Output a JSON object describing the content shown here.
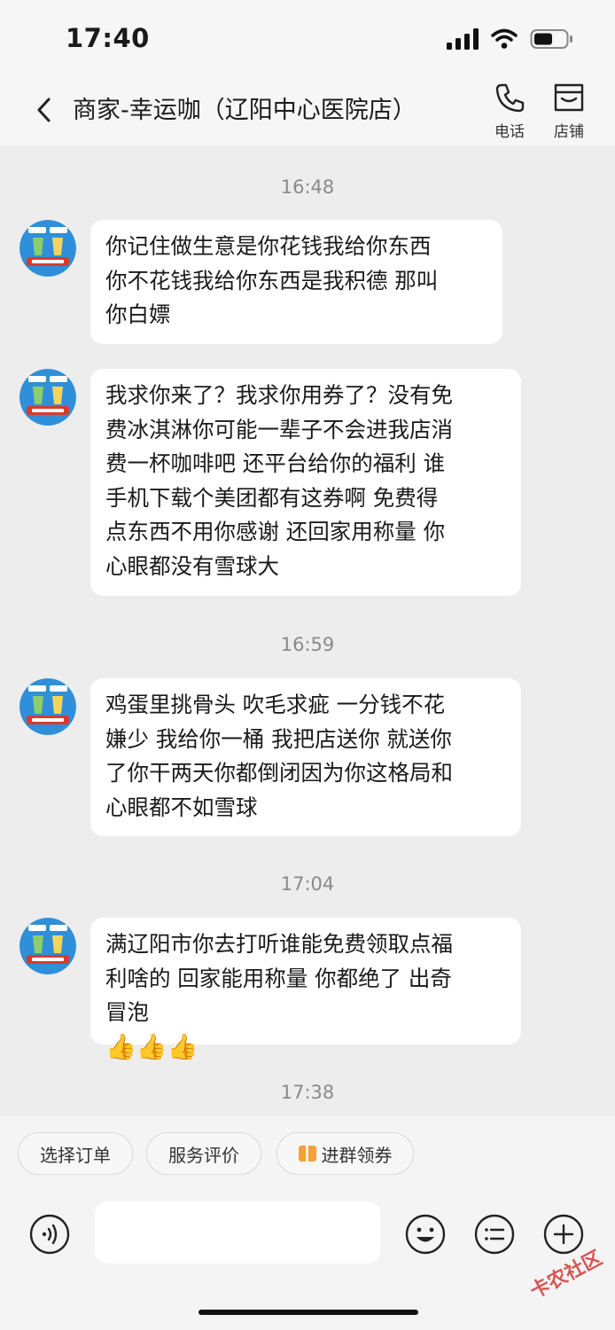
{
  "status_bar": {
    "time": "17:40"
  },
  "header": {
    "title": "商家-幸运咖（辽阳中心医院店）",
    "actions": [
      {
        "label": "电话",
        "icon": "phone-icon"
      },
      {
        "label": "店铺",
        "icon": "shop-icon"
      }
    ]
  },
  "messages": [
    {
      "time": "16:48",
      "lines": [
        "你记住做生意是你花钱我给你东西",
        "你不花钱我给你东西是我积德 那叫",
        "你白嫖"
      ]
    },
    {
      "lines": [
        "我求你来了？我求你用券了？没有免",
        "费冰淇淋你可能一辈子不会进我店消",
        "费一杯咖啡吧 还平台给你的福利 谁",
        "手机下载个美团都有这券啊 免费得",
        "点东西不用你感谢 还回家用称量 你",
        "心眼都没有雪球大"
      ]
    },
    {
      "time": "16:59",
      "lines": [
        "鸡蛋里挑骨头 吹毛求疵 一分钱不花",
        "嫌少 我给你一桶 我把店送你 就送你",
        "了你干两天你都倒闭因为你这格局和",
        "心眼都不如雪球"
      ]
    },
    {
      "time": "17:04",
      "lines": [
        "满辽阳市你去打听谁能免费领取点福",
        "利啥的 回家能用称量 你都绝了 出奇",
        "冒泡"
      ],
      "emoji": "👍👍👍"
    },
    {
      "time": "17:38"
    }
  ],
  "quick_actions": [
    "选择订单",
    "服务评价",
    "进群领券"
  ],
  "watermark": "卡农社区",
  "colors": {
    "background": "#ededed",
    "bubble": "#ffffff",
    "coupon_icon": "#f5a03a"
  }
}
